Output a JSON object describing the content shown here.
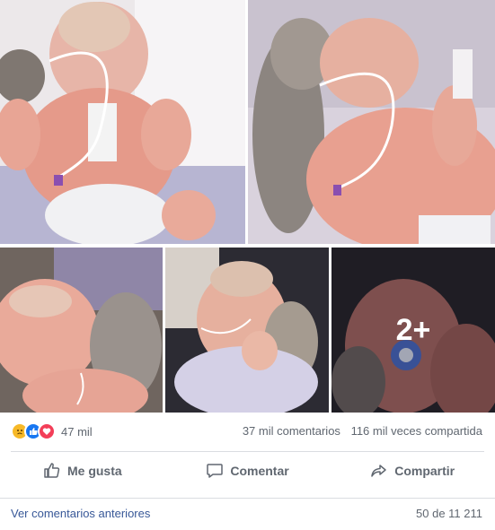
{
  "photos": [
    {
      "name": "photo-1"
    },
    {
      "name": "photo-2"
    },
    {
      "name": "photo-3"
    },
    {
      "name": "photo-4"
    },
    {
      "name": "photo-5",
      "more_label": "2+"
    }
  ],
  "reactions": {
    "icons": [
      "sad-reaction-icon",
      "like-reaction-icon",
      "love-reaction-icon"
    ],
    "colors": {
      "sad": "#f7b928",
      "like": "#1877f2",
      "love": "#f33e58"
    },
    "count": "47 mil"
  },
  "stats": {
    "comments": "37 mil comentarios",
    "shares": "116 mil veces compartida"
  },
  "actions": {
    "like": "Me gusta",
    "comment": "Comentar",
    "share": "Compartir"
  },
  "comments": {
    "prev_link": "Ver comentarios anteriores",
    "pager": "50 de 11 211"
  }
}
